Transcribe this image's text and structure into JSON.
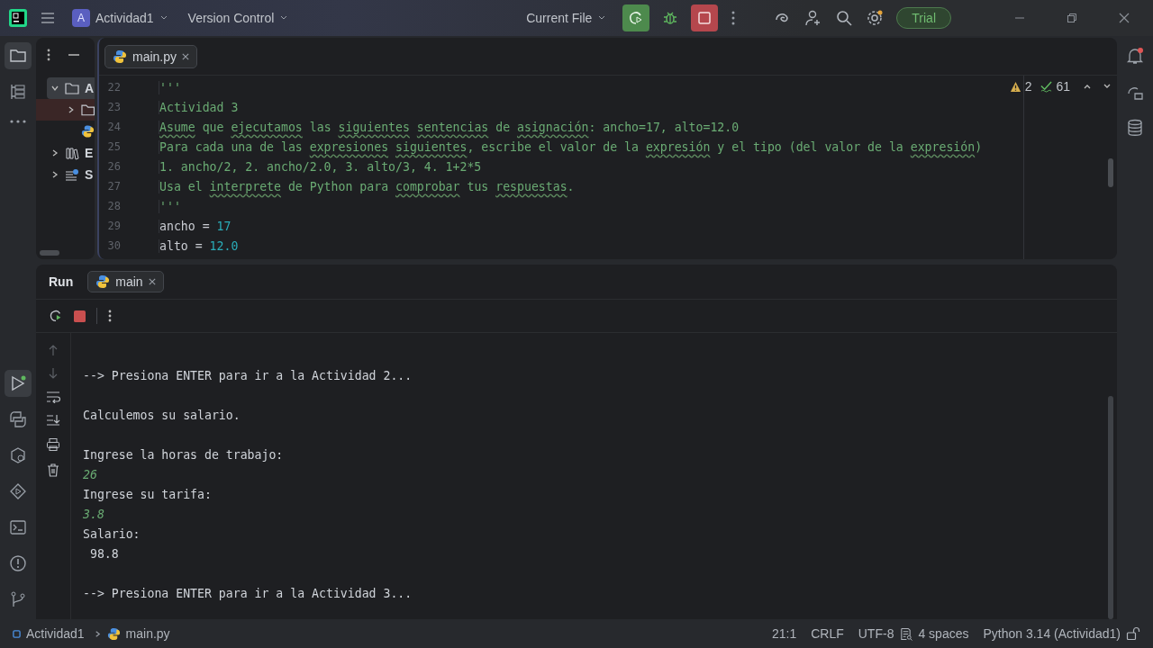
{
  "title_bar": {
    "project_badge": "A",
    "project": "Actividad1",
    "vcs": "Version Control",
    "run_config": "Current File",
    "trial": "Trial"
  },
  "project_panel": {
    "tree": [
      {
        "label": "A",
        "kind": "folder",
        "expanded": true,
        "children": [
          {
            "kind": "folder",
            "expanded": false
          },
          {
            "kind": "python"
          }
        ]
      },
      {
        "label": "E",
        "kind": "libraries",
        "expanded": false
      },
      {
        "label": "S",
        "kind": "scratches",
        "expanded": false
      }
    ]
  },
  "editor": {
    "tabs": [
      {
        "label": "main.py",
        "selected": true
      }
    ],
    "warnings": "2",
    "checks": "61",
    "lines": [
      {
        "number": "22",
        "tokens": [
          {
            "text": "'''",
            "kind": "string"
          }
        ]
      },
      {
        "number": "23",
        "tokens": [
          {
            "text": "Actividad 3",
            "kind": "string"
          }
        ]
      },
      {
        "number": "24",
        "tokens": [
          {
            "text": "Asume",
            "kind": "typo"
          },
          {
            "text": " que ",
            "kind": "string"
          },
          {
            "text": "ejecutamos",
            "kind": "typo"
          },
          {
            "text": " las ",
            "kind": "string"
          },
          {
            "text": "siguientes",
            "kind": "typo",
            "space_after": true
          },
          {
            "text": "sentencias",
            "kind": "typo"
          },
          {
            "text": " de ",
            "kind": "string"
          },
          {
            "text": "asignación",
            "kind": "typo"
          },
          {
            "text": ": ancho=17, alto=12.0",
            "kind": "string"
          }
        ]
      },
      {
        "number": "25",
        "tokens": [
          {
            "text": "Para cada una de las ",
            "kind": "string"
          },
          {
            "text": "expresiones",
            "kind": "typo",
            "space_after": true
          },
          {
            "text": "siguientes",
            "kind": "typo"
          },
          {
            "text": ", escribe el valor de la ",
            "kind": "string"
          },
          {
            "text": "expresión",
            "kind": "typo"
          },
          {
            "text": " y el tipo (del valor de la ",
            "kind": "string"
          },
          {
            "text": "expresión",
            "kind": "typo"
          },
          {
            "text": ")",
            "kind": "string"
          }
        ]
      },
      {
        "number": "26",
        "tokens": [
          {
            "text": "1. ancho/2, 2. ancho/2.0, 3. alto/3, 4. 1+2*5",
            "kind": "string"
          }
        ]
      },
      {
        "number": "27",
        "tokens": [
          {
            "text": "Usa el ",
            "kind": "string"
          },
          {
            "text": "interprete",
            "kind": "typo"
          },
          {
            "text": " de Python para ",
            "kind": "string"
          },
          {
            "text": "comprobar",
            "kind": "typo"
          },
          {
            "text": " tus ",
            "kind": "string"
          },
          {
            "text": "respuestas",
            "kind": "typo"
          },
          {
            "text": ".",
            "kind": "string"
          }
        ]
      },
      {
        "number": "28",
        "tokens": [
          {
            "text": "'''",
            "kind": "string"
          }
        ]
      },
      {
        "number": "29",
        "tokens": [
          {
            "text": "ancho = ",
            "kind": "plain"
          },
          {
            "text": "17",
            "kind": "number"
          }
        ]
      },
      {
        "number": "30",
        "tokens": [
          {
            "text": "alto = ",
            "kind": "plain"
          },
          {
            "text": "12.0",
            "kind": "number"
          }
        ]
      }
    ]
  },
  "run_panel": {
    "title": "Run",
    "tabs": [
      {
        "label": "main",
        "selected": true
      }
    ],
    "console": [
      {
        "kind": "blank"
      },
      {
        "kind": "output",
        "text": "--> Presiona ENTER para ir a la Actividad 2..."
      },
      {
        "kind": "blank"
      },
      {
        "kind": "output",
        "text": "Calculemos su salario."
      },
      {
        "kind": "blank"
      },
      {
        "kind": "output",
        "text": "Ingrese la horas de trabajo:"
      },
      {
        "kind": "input",
        "text": "26"
      },
      {
        "kind": "output",
        "text": "Ingrese su tarifa:"
      },
      {
        "kind": "input",
        "text": "3.8"
      },
      {
        "kind": "output",
        "text": "Salario:"
      },
      {
        "kind": "output",
        "text": " 98.8"
      },
      {
        "kind": "blank"
      },
      {
        "kind": "output",
        "text": "--> Presiona ENTER para ir a la Actividad 3..."
      }
    ]
  },
  "status_bar": {
    "breadcrumbs": [
      "Actividad1",
      "main.py"
    ],
    "position": "21:1",
    "line_ending": "CRLF",
    "encoding": "UTF-8",
    "indent": "4 spaces",
    "interpreter": "Python 3.14 (Actividad1)"
  }
}
